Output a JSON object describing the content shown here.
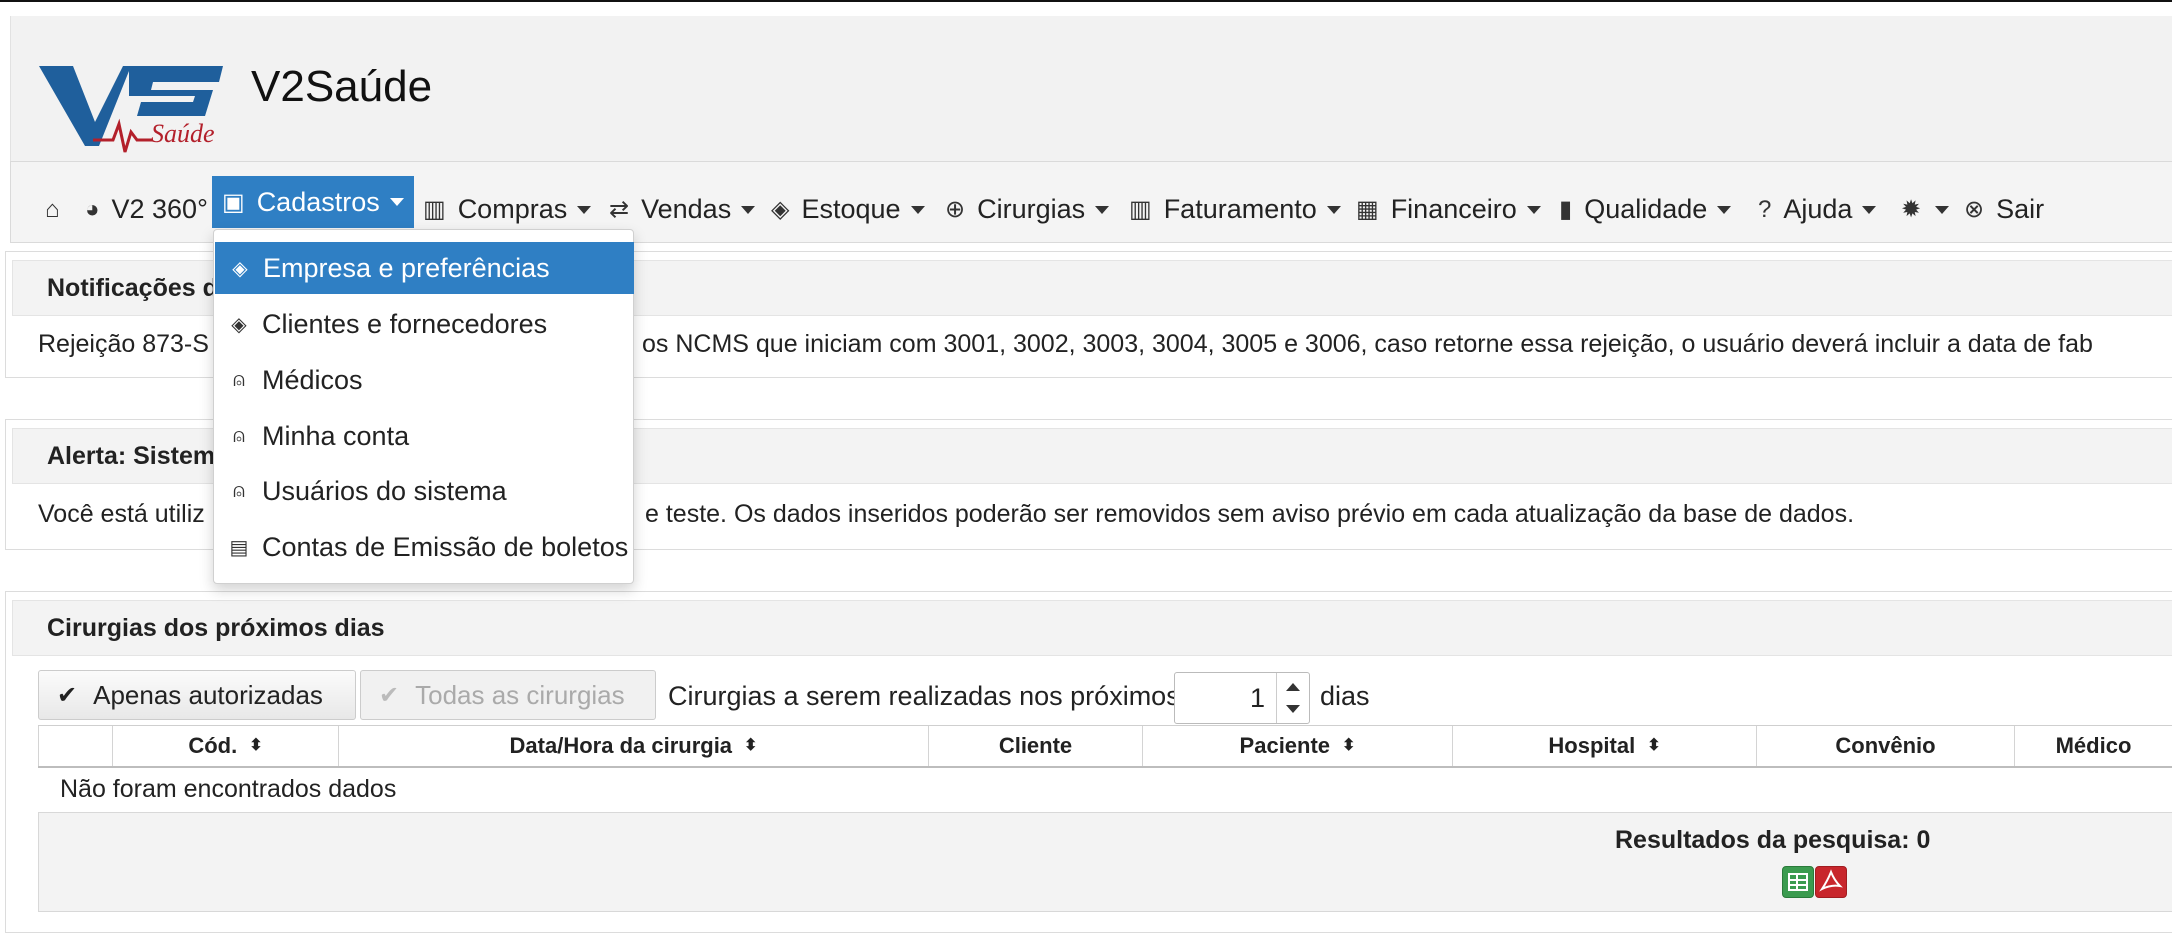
{
  "app": {
    "title": "V2Saúde",
    "logo_text": "V2",
    "logo_script": "Saúde"
  },
  "menu": {
    "home_icon": "home-icon",
    "items": [
      {
        "label": "V2 360°",
        "icon": "pie-chart-icon"
      },
      {
        "label": "Cadastros",
        "icon": "floppy-icon"
      },
      {
        "label": "Compras",
        "icon": "briefcase-icon"
      },
      {
        "label": "Vendas",
        "icon": "exchange-icon"
      },
      {
        "label": "Estoque",
        "icon": "tag-icon"
      },
      {
        "label": "Cirurgias",
        "icon": "plus-circle-icon"
      },
      {
        "label": "Faturamento",
        "icon": "briefcase-icon"
      },
      {
        "label": "Financeiro",
        "icon": "table-icon"
      },
      {
        "label": "Qualidade",
        "icon": "book-icon"
      },
      {
        "label": "Ajuda",
        "icon": "question-icon"
      },
      {
        "label": "",
        "icon": "gear-icon"
      },
      {
        "label": "Sair",
        "icon": "close-circle-icon"
      }
    ]
  },
  "dropdown": {
    "items": [
      {
        "label": "Empresa e preferências",
        "icon": "tag-icon"
      },
      {
        "label": "Clientes e fornecedores",
        "icon": "tag-icon"
      },
      {
        "label": "Médicos",
        "icon": "user-icon"
      },
      {
        "label": "Minha conta",
        "icon": "user-icon"
      },
      {
        "label": "Usuários do sistema",
        "icon": "user-icon"
      },
      {
        "label": "Contas de Emissão de boletos",
        "icon": "id-card-icon"
      }
    ]
  },
  "panels": {
    "notifications": {
      "title": "Notificações d",
      "body_left": "Rejeição 873-S",
      "body_right": "os NCMS que iniciam com 3001, 3002, 3003, 3004, 3005 e 3006, caso retorne essa rejeição, o usuário deverá incluir a data de fab"
    },
    "alert": {
      "title": "Alerta: Sistem",
      "body_left": "Você está utiliz",
      "body_right": "e teste. Os dados inseridos poderão ser removidos sem aviso prévio em cada atualização da base de dados."
    },
    "cirurgias": {
      "title": "Cirurgias dos próximos dias",
      "btn_autorizadas": "Apenas autorizadas",
      "btn_todas": "Todas as cirurgias",
      "days_prefix": "Cirurgias a serem realizadas nos próximos",
      "days_value": "1",
      "days_suffix": "dias",
      "columns": [
        "Cód.",
        "Data/Hora da cirurgia",
        "Cliente",
        "Paciente",
        "Hospital",
        "Convênio",
        "Médico"
      ],
      "empty_text": "Não foram encontrados dados",
      "results_label": "Resultados da pesquisa: 0"
    }
  }
}
